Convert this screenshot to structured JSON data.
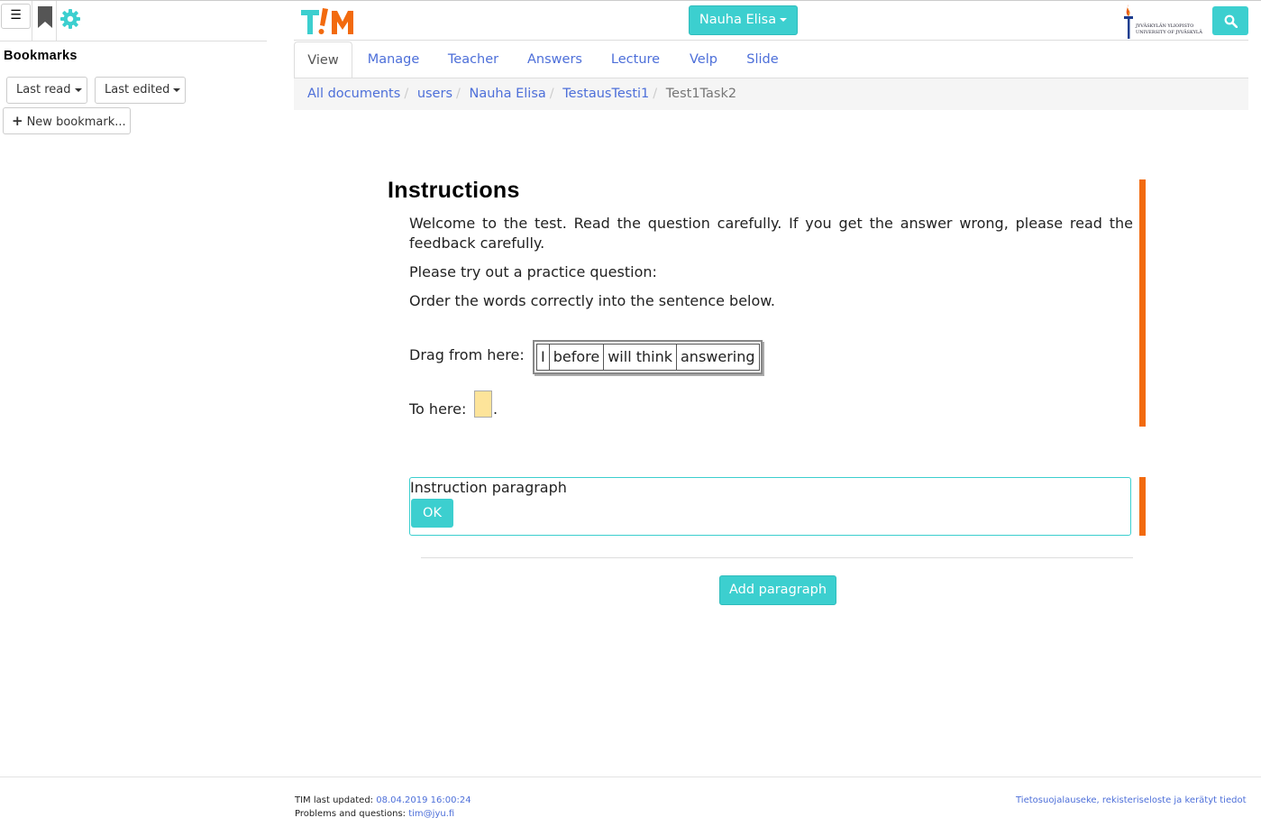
{
  "sidebar": {
    "menu_icon": "☰",
    "bookmarks_title": "Bookmarks",
    "last_read_label": "Last read",
    "last_edited_label": "Last edited",
    "new_bookmark_label": "New bookmark..."
  },
  "header": {
    "logo_text": "T!M",
    "user_menu_label": "Nauha Elisa",
    "university_line1": "JYVÄSKYLÄN YLIOPISTO",
    "university_line2": "UNIVERSITY OF JYVÄSKYLÄ"
  },
  "tabs": [
    "View",
    "Manage",
    "Teacher",
    "Answers",
    "Lecture",
    "Velp",
    "Slide"
  ],
  "breadcrumb": {
    "items": [
      "All documents",
      "users",
      "Nauha Elisa",
      "TestausTesti1"
    ],
    "current": "Test1Task2"
  },
  "document": {
    "title": "Instructions",
    "welcome_text": "Welcome to the test. Read the question carefully. If you get the answer wrong, please read the feedback carefully.",
    "practice_text": "Please try out a practice question:",
    "order_text": "Order the words correctly into the sentence below.",
    "drag_label": "Drag from here:",
    "words": [
      "I",
      "before",
      "will think",
      "answering"
    ],
    "drop_label": "To here:",
    "drop_suffix": ".",
    "edit_box_label": "Instruction paragraph",
    "ok_label": "OK",
    "add_paragraph_label": "Add paragraph"
  },
  "colors": {
    "accent": "#3ccfcf",
    "link": "#4d6fd9",
    "marker": "#f26a0e",
    "drop_zone": "#fde49a"
  },
  "footer": {
    "updated_label": "TIM last updated:",
    "updated_value": "08.04.2019 16:00:24",
    "problems_label": "Problems and questions:",
    "problems_email": "tim@jyu.fi",
    "privacy_link": "Tietosuojalauseke, rekisteriseloste ja kerätyt tiedot"
  }
}
